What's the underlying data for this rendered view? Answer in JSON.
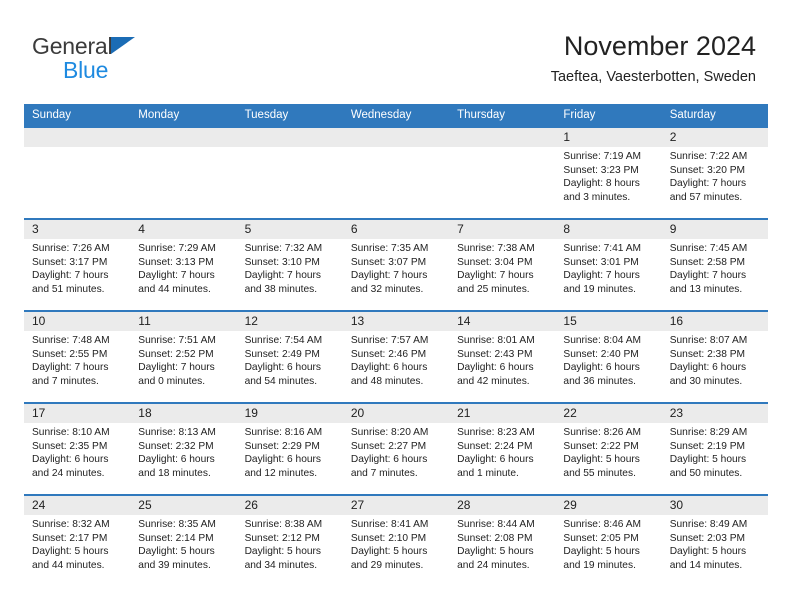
{
  "logo": {
    "word_top": "General",
    "word_bottom": "Blue",
    "triangle_icon": "triangle-icon",
    "brand_blue": "#1e8ae0",
    "brand_dark": "#3b3b3b"
  },
  "header": {
    "title": "November 2024",
    "subtitle": "Taeftea, Vaesterbotten, Sweden"
  },
  "theme": {
    "header_bg": "#3079bd",
    "daynum_bg": "#ebebeb",
    "row_border": "#3079bd",
    "text": "#222222"
  },
  "weekday_headers": [
    "Sunday",
    "Monday",
    "Tuesday",
    "Wednesday",
    "Thursday",
    "Friday",
    "Saturday"
  ],
  "weeks": [
    [
      {
        "day": "",
        "empty": true,
        "lines": []
      },
      {
        "day": "",
        "empty": true,
        "lines": []
      },
      {
        "day": "",
        "empty": true,
        "lines": []
      },
      {
        "day": "",
        "empty": true,
        "lines": []
      },
      {
        "day": "",
        "empty": true,
        "lines": []
      },
      {
        "day": "1",
        "empty": false,
        "lines": [
          "Sunrise: 7:19 AM",
          "Sunset: 3:23 PM",
          "Daylight: 8 hours",
          "and 3 minutes."
        ]
      },
      {
        "day": "2",
        "empty": false,
        "lines": [
          "Sunrise: 7:22 AM",
          "Sunset: 3:20 PM",
          "Daylight: 7 hours",
          "and 57 minutes."
        ]
      }
    ],
    [
      {
        "day": "3",
        "empty": false,
        "lines": [
          "Sunrise: 7:26 AM",
          "Sunset: 3:17 PM",
          "Daylight: 7 hours",
          "and 51 minutes."
        ]
      },
      {
        "day": "4",
        "empty": false,
        "lines": [
          "Sunrise: 7:29 AM",
          "Sunset: 3:13 PM",
          "Daylight: 7 hours",
          "and 44 minutes."
        ]
      },
      {
        "day": "5",
        "empty": false,
        "lines": [
          "Sunrise: 7:32 AM",
          "Sunset: 3:10 PM",
          "Daylight: 7 hours",
          "and 38 minutes."
        ]
      },
      {
        "day": "6",
        "empty": false,
        "lines": [
          "Sunrise: 7:35 AM",
          "Sunset: 3:07 PM",
          "Daylight: 7 hours",
          "and 32 minutes."
        ]
      },
      {
        "day": "7",
        "empty": false,
        "lines": [
          "Sunrise: 7:38 AM",
          "Sunset: 3:04 PM",
          "Daylight: 7 hours",
          "and 25 minutes."
        ]
      },
      {
        "day": "8",
        "empty": false,
        "lines": [
          "Sunrise: 7:41 AM",
          "Sunset: 3:01 PM",
          "Daylight: 7 hours",
          "and 19 minutes."
        ]
      },
      {
        "day": "9",
        "empty": false,
        "lines": [
          "Sunrise: 7:45 AM",
          "Sunset: 2:58 PM",
          "Daylight: 7 hours",
          "and 13 minutes."
        ]
      }
    ],
    [
      {
        "day": "10",
        "empty": false,
        "lines": [
          "Sunrise: 7:48 AM",
          "Sunset: 2:55 PM",
          "Daylight: 7 hours",
          "and 7 minutes."
        ]
      },
      {
        "day": "11",
        "empty": false,
        "lines": [
          "Sunrise: 7:51 AM",
          "Sunset: 2:52 PM",
          "Daylight: 7 hours",
          "and 0 minutes."
        ]
      },
      {
        "day": "12",
        "empty": false,
        "lines": [
          "Sunrise: 7:54 AM",
          "Sunset: 2:49 PM",
          "Daylight: 6 hours",
          "and 54 minutes."
        ]
      },
      {
        "day": "13",
        "empty": false,
        "lines": [
          "Sunrise: 7:57 AM",
          "Sunset: 2:46 PM",
          "Daylight: 6 hours",
          "and 48 minutes."
        ]
      },
      {
        "day": "14",
        "empty": false,
        "lines": [
          "Sunrise: 8:01 AM",
          "Sunset: 2:43 PM",
          "Daylight: 6 hours",
          "and 42 minutes."
        ]
      },
      {
        "day": "15",
        "empty": false,
        "lines": [
          "Sunrise: 8:04 AM",
          "Sunset: 2:40 PM",
          "Daylight: 6 hours",
          "and 36 minutes."
        ]
      },
      {
        "day": "16",
        "empty": false,
        "lines": [
          "Sunrise: 8:07 AM",
          "Sunset: 2:38 PM",
          "Daylight: 6 hours",
          "and 30 minutes."
        ]
      }
    ],
    [
      {
        "day": "17",
        "empty": false,
        "lines": [
          "Sunrise: 8:10 AM",
          "Sunset: 2:35 PM",
          "Daylight: 6 hours",
          "and 24 minutes."
        ]
      },
      {
        "day": "18",
        "empty": false,
        "lines": [
          "Sunrise: 8:13 AM",
          "Sunset: 2:32 PM",
          "Daylight: 6 hours",
          "and 18 minutes."
        ]
      },
      {
        "day": "19",
        "empty": false,
        "lines": [
          "Sunrise: 8:16 AM",
          "Sunset: 2:29 PM",
          "Daylight: 6 hours",
          "and 12 minutes."
        ]
      },
      {
        "day": "20",
        "empty": false,
        "lines": [
          "Sunrise: 8:20 AM",
          "Sunset: 2:27 PM",
          "Daylight: 6 hours",
          "and 7 minutes."
        ]
      },
      {
        "day": "21",
        "empty": false,
        "lines": [
          "Sunrise: 8:23 AM",
          "Sunset: 2:24 PM",
          "Daylight: 6 hours",
          "and 1 minute."
        ]
      },
      {
        "day": "22",
        "empty": false,
        "lines": [
          "Sunrise: 8:26 AM",
          "Sunset: 2:22 PM",
          "Daylight: 5 hours",
          "and 55 minutes."
        ]
      },
      {
        "day": "23",
        "empty": false,
        "lines": [
          "Sunrise: 8:29 AM",
          "Sunset: 2:19 PM",
          "Daylight: 5 hours",
          "and 50 minutes."
        ]
      }
    ],
    [
      {
        "day": "24",
        "empty": false,
        "lines": [
          "Sunrise: 8:32 AM",
          "Sunset: 2:17 PM",
          "Daylight: 5 hours",
          "and 44 minutes."
        ]
      },
      {
        "day": "25",
        "empty": false,
        "lines": [
          "Sunrise: 8:35 AM",
          "Sunset: 2:14 PM",
          "Daylight: 5 hours",
          "and 39 minutes."
        ]
      },
      {
        "day": "26",
        "empty": false,
        "lines": [
          "Sunrise: 8:38 AM",
          "Sunset: 2:12 PM",
          "Daylight: 5 hours",
          "and 34 minutes."
        ]
      },
      {
        "day": "27",
        "empty": false,
        "lines": [
          "Sunrise: 8:41 AM",
          "Sunset: 2:10 PM",
          "Daylight: 5 hours",
          "and 29 minutes."
        ]
      },
      {
        "day": "28",
        "empty": false,
        "lines": [
          "Sunrise: 8:44 AM",
          "Sunset: 2:08 PM",
          "Daylight: 5 hours",
          "and 24 minutes."
        ]
      },
      {
        "day": "29",
        "empty": false,
        "lines": [
          "Sunrise: 8:46 AM",
          "Sunset: 2:05 PM",
          "Daylight: 5 hours",
          "and 19 minutes."
        ]
      },
      {
        "day": "30",
        "empty": false,
        "lines": [
          "Sunrise: 8:49 AM",
          "Sunset: 2:03 PM",
          "Daylight: 5 hours",
          "and 14 minutes."
        ]
      }
    ]
  ]
}
